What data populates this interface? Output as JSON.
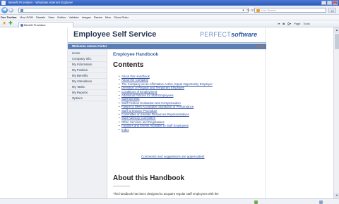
{
  "browser": {
    "window_title": "Benefit Providers - Windows Internet Explorer",
    "address": "",
    "search_placeholder": "Live Search",
    "dev_toolbar_label": "Dev Toolbar",
    "menu": [
      "View DOM",
      "Disable",
      "View",
      "Outline",
      "Validate",
      "Images",
      "Resize",
      "Misc",
      "Show Ruler"
    ],
    "tab_title": "Benefit Providers",
    "commands": [
      "Page",
      "Tools"
    ]
  },
  "page": {
    "title": "Employee Self Service",
    "brand_part1": "PERFECT",
    "brand_part2": "software",
    "welcome": "Welcome James Carter",
    "logoff": "Logoff",
    "sidebar": [
      "Home",
      "Company Info.",
      "My Information",
      "My Position",
      "My Benefits",
      "My Attendance",
      "My Tasks",
      "My Reports",
      "Options"
    ],
    "breadcrumb": "Employee Handbook",
    "contents_heading": "Contents",
    "toc": [
      "About this Handbook",
      "About the Company",
      "The Company as an Affirmative Action, Equal Opportunity Employer",
      "Definition of Regular and Temporary Employee",
      "Conditions of Employment",
      "Additional Policies for Staff Employees",
      "Staff Benefits",
      "Staff Position Evaluation and Compensation",
      "Failure to Meet Acceptable Standards of Performance",
      "Staff Grievance Procedure",
      "Committee on Human Resources Representatives",
      "Staff Advisory Committee",
      "Other Services and Regulations",
      "Facilities and Events Available to Staff Employees",
      "Index"
    ],
    "suggestions_link": "Comments and suggestions are appreciated!",
    "section_heading": "About this Handbook",
    "intro_text": "This handbook has been designed to acquaint regular staff employees with the"
  },
  "colors": {
    "accent_blue": "#5b7fb5",
    "link_blue": "#2d4fa0",
    "logoff_orange": "#d96b2b"
  }
}
